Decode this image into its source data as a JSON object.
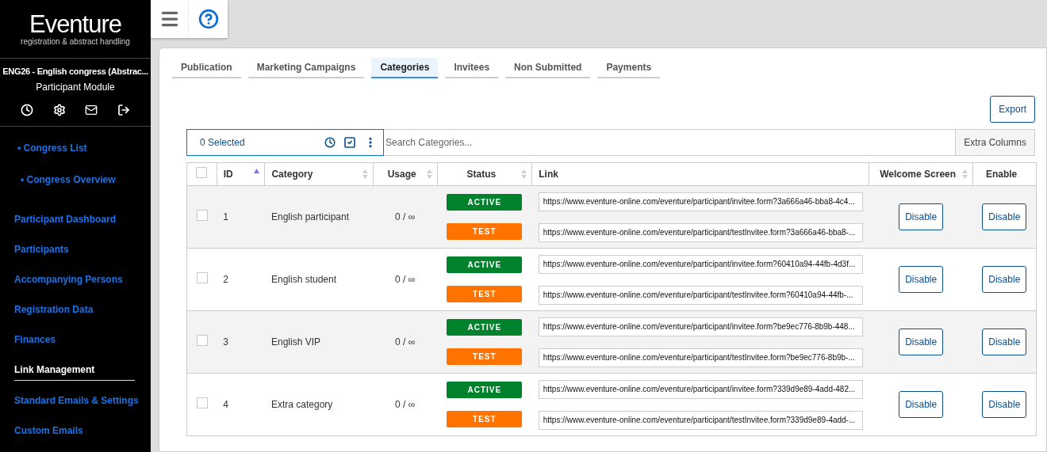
{
  "brand": {
    "name": "Eventure",
    "tagline": "registration & abstract handling"
  },
  "congress": {
    "title": "ENG26 - English congress (Abstrac...",
    "module": "Participant Module"
  },
  "sidebar": {
    "top_links": [
      {
        "label": "• Congress List"
      },
      {
        "label": "• Congress Overview"
      }
    ],
    "items": [
      {
        "label": "Participant Dashboard",
        "selected": false
      },
      {
        "label": "Participants",
        "selected": false
      },
      {
        "label": "Accompanying Persons",
        "selected": false
      },
      {
        "label": "Registration Data",
        "selected": false
      },
      {
        "label": "Finances",
        "selected": false
      },
      {
        "label": "Link Management",
        "selected": true
      },
      {
        "label": "Standard Emails & Settings",
        "selected": false
      },
      {
        "label": "Custom Emails",
        "selected": false
      }
    ]
  },
  "tabs": [
    {
      "label": "Publication",
      "selected": false
    },
    {
      "label": "Marketing Campaigns",
      "selected": false
    },
    {
      "label": "Categories",
      "selected": true
    },
    {
      "label": "Invitees",
      "selected": false
    },
    {
      "label": "Non Submitted",
      "selected": false
    },
    {
      "label": "Payments",
      "selected": false
    }
  ],
  "export_button": "Export",
  "toolbar": {
    "selected_count": "0 Selected",
    "search_placeholder": "Search Categories...",
    "extra_columns": "Extra Columns"
  },
  "table": {
    "select_all_checked": false,
    "columns": [
      {
        "label": "ID",
        "sorted": true
      },
      {
        "label": "Category",
        "sorted": false
      },
      {
        "label": "Usage",
        "sorted": false
      },
      {
        "label": "Status",
        "sorted": false
      },
      {
        "label": "Link"
      },
      {
        "label": "Welcome Screen",
        "sorted": false
      },
      {
        "label": "Enable"
      }
    ],
    "rows": [
      {
        "checked": false,
        "id": "1",
        "category": "English participant",
        "usage": "0 / ∞",
        "statuses": [
          {
            "kind": "active",
            "label": "ACTIVE"
          },
          {
            "kind": "test",
            "label": "TEST"
          }
        ],
        "links": [
          "https://www.eventure-online.com/eventure/participant/invitee.form?3a666a46-bba8-4c4...",
          "https://www.eventure-online.com/eventure/participant/testInvitee.form?3a666a46-bba8-..."
        ],
        "welcome_button": "Disable",
        "enable_button": "Disable"
      },
      {
        "checked": false,
        "id": "2",
        "category": "English student",
        "usage": "0 / ∞",
        "statuses": [
          {
            "kind": "active",
            "label": "ACTIVE"
          },
          {
            "kind": "test",
            "label": "TEST"
          }
        ],
        "links": [
          "https://www.eventure-online.com/eventure/participant/invitee.form?60410a94-44fb-4d3f...",
          "https://www.eventure-online.com/eventure/participant/testInvitee.form?60410a94-44fb-..."
        ],
        "welcome_button": "Disable",
        "enable_button": "Disable"
      },
      {
        "checked": false,
        "id": "3",
        "category": "English VIP",
        "usage": "0 / ∞",
        "statuses": [
          {
            "kind": "active",
            "label": "ACTIVE"
          },
          {
            "kind": "test",
            "label": "TEST"
          }
        ],
        "links": [
          "https://www.eventure-online.com/eventure/participant/invitee.form?be9ec776-8b9b-448...",
          "https://www.eventure-online.com/eventure/participant/testInvitee.form?be9ec776-8b9b-..."
        ],
        "welcome_button": "Disable",
        "enable_button": "Disable"
      },
      {
        "checked": false,
        "id": "4",
        "category": "Extra category",
        "usage": "0 / ∞",
        "statuses": [
          {
            "kind": "active",
            "label": "ACTIVE"
          },
          {
            "kind": "test",
            "label": "TEST"
          }
        ],
        "links": [
          "https://www.eventure-online.com/eventure/participant/invitee.form?339d9e89-4add-482...",
          "https://www.eventure-online.com/eventure/participant/testInvitee.form?339d9e89-4add-..."
        ],
        "welcome_button": "Disable",
        "enable_button": "Disable"
      }
    ]
  }
}
